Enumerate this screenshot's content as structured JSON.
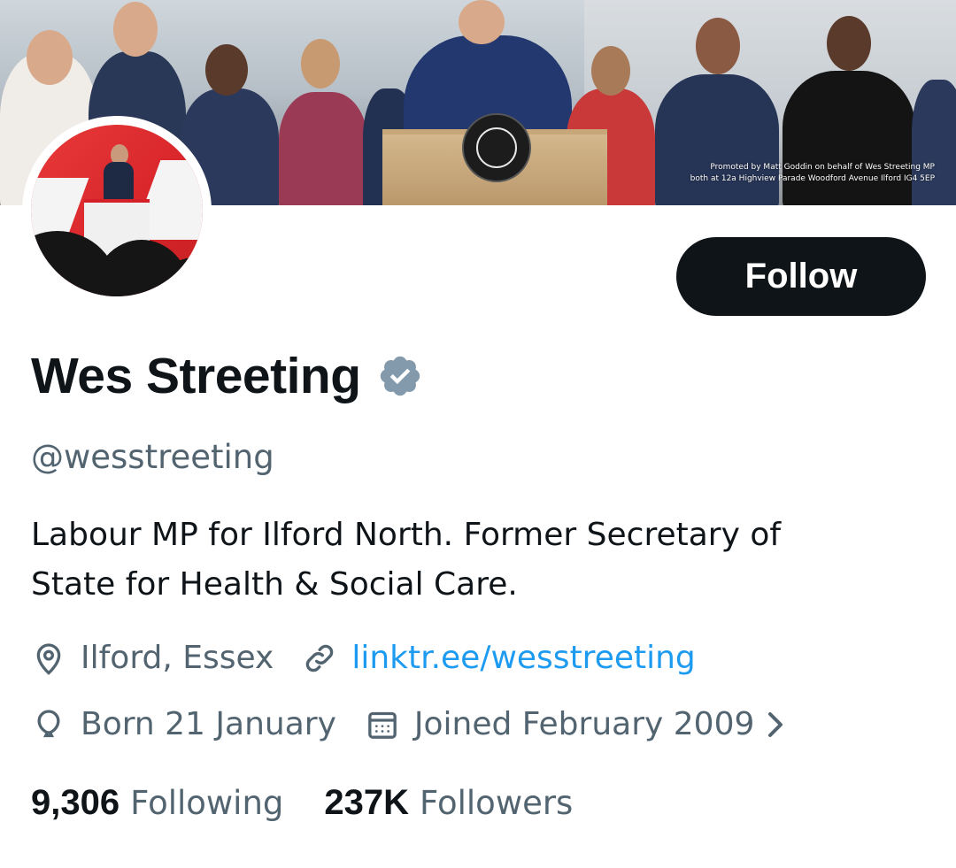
{
  "banner": {
    "promoted_line1": "Promoted by Matt Goddin on behalf of Wes Streeting MP",
    "promoted_line2": "both at 12a Highview Parade Woodford Avenue Ilford IG4 5EP"
  },
  "actions": {
    "follow_label": "Follow"
  },
  "profile": {
    "display_name": "Wes Streeting",
    "handle": "@wesstreeting",
    "bio_line1": "Labour MP for Ilford North. Former Secretary of",
    "bio_line2": "State for Health & Social Care.",
    "location": "Ilford, Essex",
    "website": "linktr.ee/wesstreeting",
    "birthday": "Born 21 January",
    "joined": "Joined February 2009"
  },
  "stats": {
    "following_count": "9,306",
    "following_label": "Following",
    "followers_count": "237K",
    "followers_label": "Followers"
  },
  "icons": {
    "verified": "verified-badge-icon",
    "location": "location-pin-icon",
    "link": "link-icon",
    "birthday": "balloon-icon",
    "calendar": "calendar-icon",
    "chevron": "chevron-right-icon"
  },
  "colors": {
    "text_primary": "#0f1419",
    "text_secondary": "#536471",
    "link": "#1d9bf0",
    "verified": "#829aab",
    "button_bg": "#0f1419"
  }
}
